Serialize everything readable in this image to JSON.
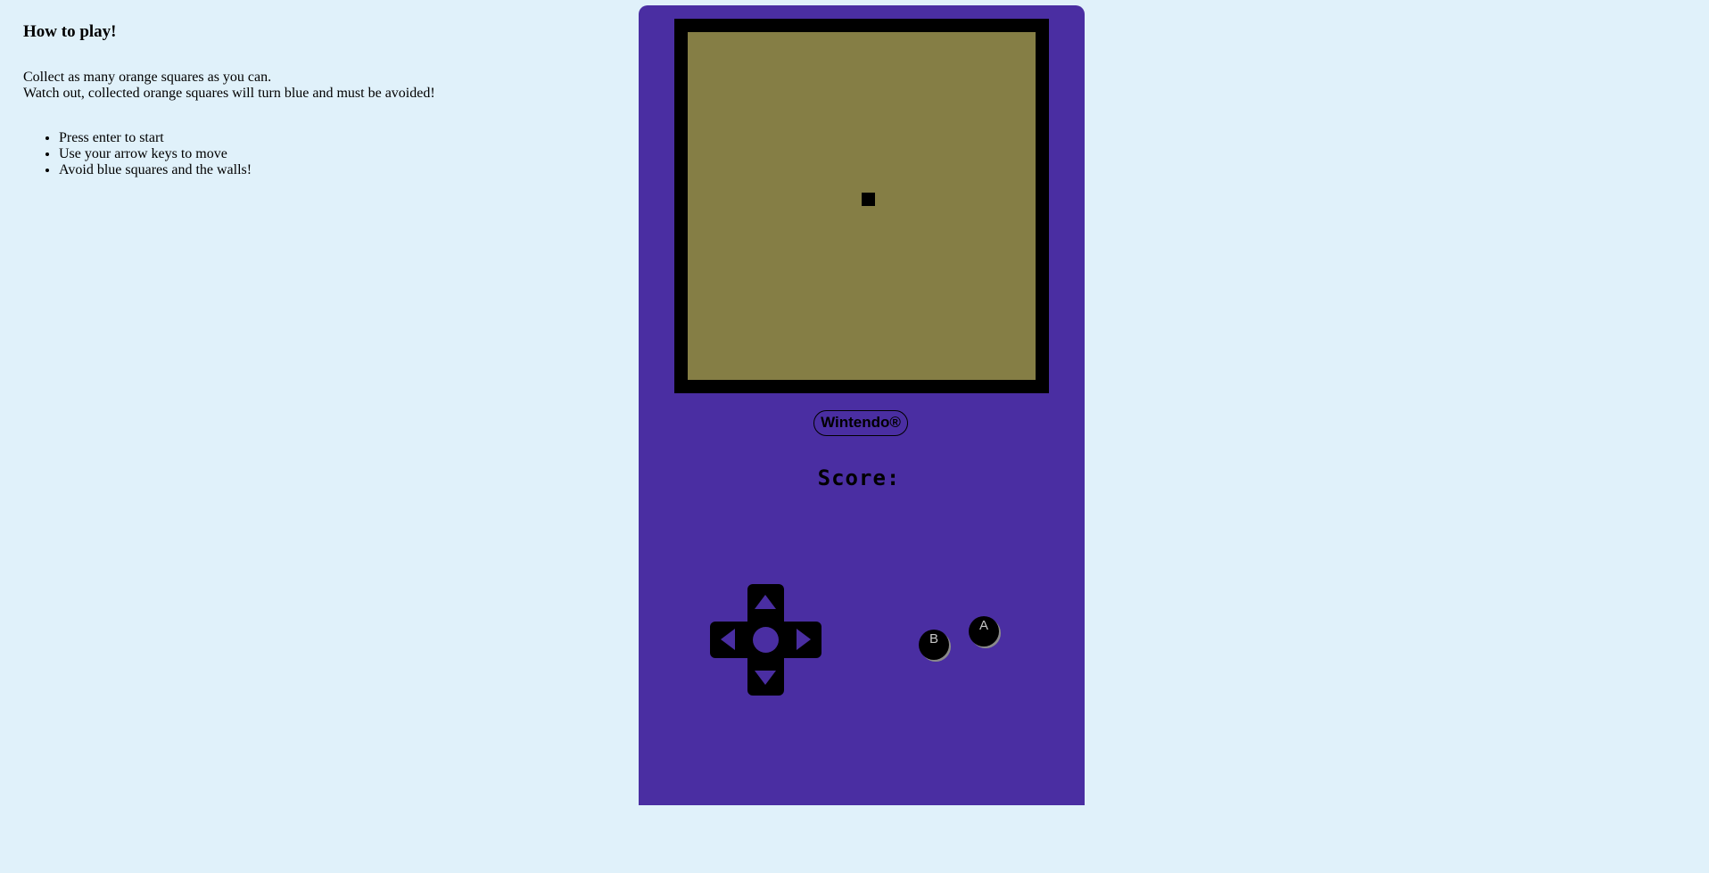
{
  "instructions": {
    "title": "How to play!",
    "intro_line1": "Collect as many orange squares as you can.",
    "intro_line2": "Watch out, collected orange squares will turn blue and must be avoided!",
    "steps": [
      "Press enter to start",
      "Use your arrow keys to move",
      "Avoid blue squares and the walls!"
    ]
  },
  "console": {
    "brand": "Wintendo®",
    "score_label": "Score:",
    "score_value": "",
    "button_a": "A",
    "button_b": "B"
  },
  "colors": {
    "page_background": "#e0f1fa",
    "console_body": "#4a2ea2",
    "screen_bezel": "#000000",
    "screen": "#857e45",
    "snake": "#000000",
    "button_label": "#c8c8c8"
  },
  "icons": {
    "dpad_up": "triangle-up-icon",
    "dpad_down": "triangle-down-icon",
    "dpad_left": "triangle-left-icon",
    "dpad_right": "triangle-right-icon"
  }
}
